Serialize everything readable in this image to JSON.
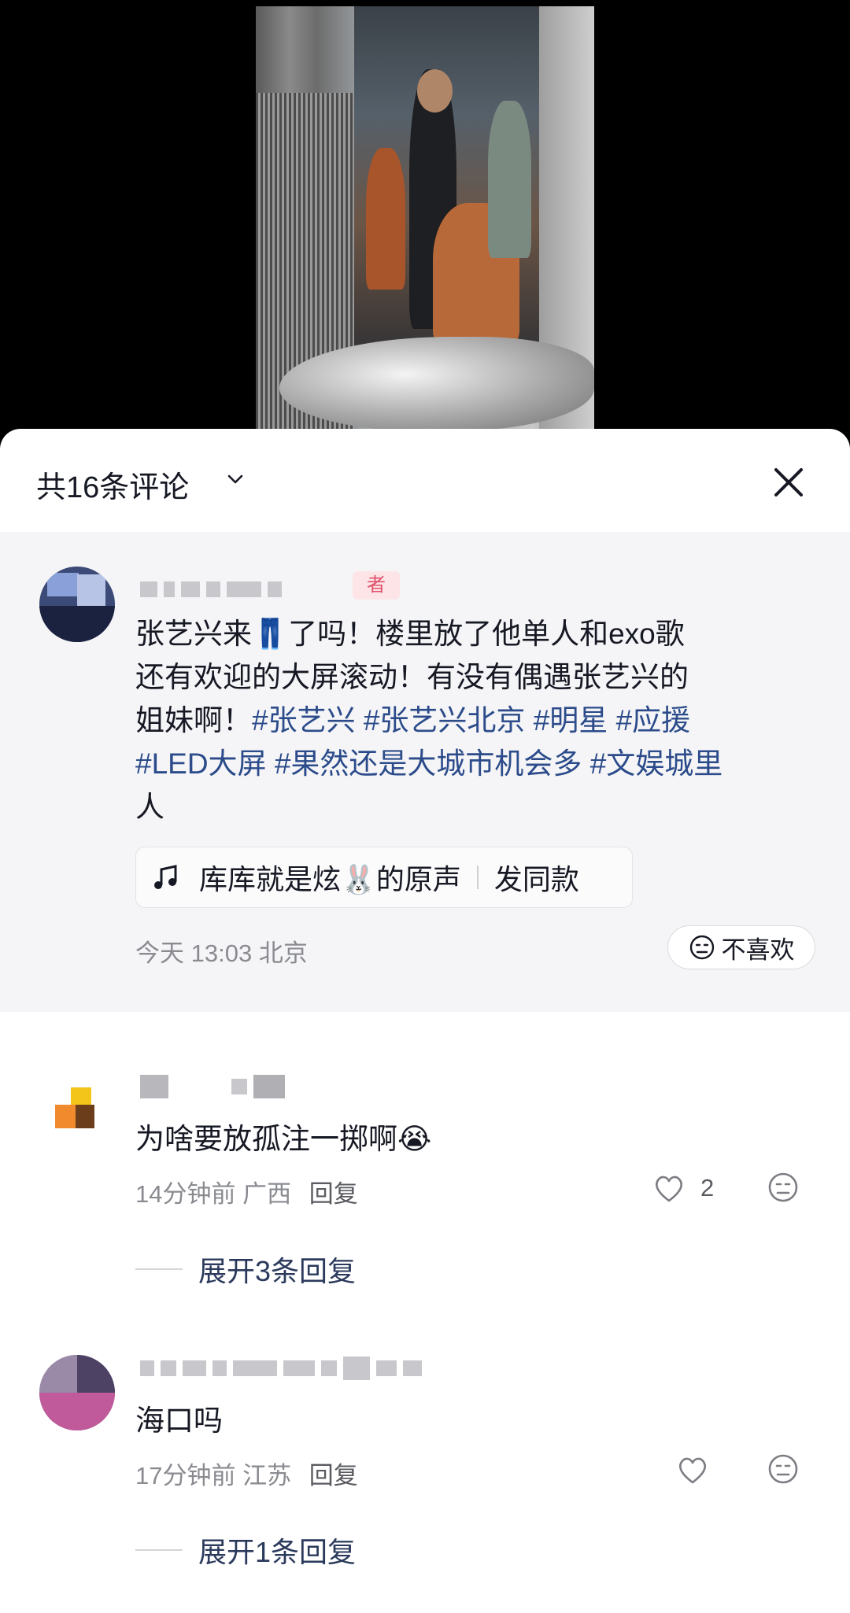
{
  "header": {
    "title": "共16条评论"
  },
  "top_comment": {
    "badge": "者",
    "text_line1": "张艺兴来👖了吗！楼里放了他单人和exo歌",
    "text_line2": "还有欢迎的大屏滚动！有没有偶遇张艺兴的",
    "text_line3_plain": "姐妹啊！",
    "tags_line3": [
      "#张艺兴",
      "#张艺兴北京",
      "#明星",
      "#应援"
    ],
    "tags_line4": [
      "#LED大屏",
      "#果然还是大城市机会多",
      "#文娱城里"
    ],
    "text_line5": "人",
    "music": {
      "title": "库库就是炫🐰的原声",
      "action": "发同款"
    },
    "time": "今天 13:03",
    "location": "北京",
    "dislike_label": "不喜欢"
  },
  "comments": [
    {
      "text": "为啥要放孤注一掷啊😭",
      "time": "14分钟前",
      "location": "广西",
      "reply_label": "回复",
      "likes": "2",
      "expand_label": "展开3条回复"
    },
    {
      "text": "海口吗",
      "time": "17分钟前",
      "location": "江苏",
      "reply_label": "回复",
      "likes": "",
      "expand_label": "展开1条回复"
    }
  ],
  "icons": {
    "chevron": "chevron-down-icon",
    "close": "close-icon",
    "music": "music-note-icon",
    "dislike": "dislike-face-icon",
    "like": "heart-icon"
  },
  "colors": {
    "hashtag": "#2b4b8a",
    "meta": "#8a8b91",
    "top_comment_bg": "#f5f5f7"
  }
}
